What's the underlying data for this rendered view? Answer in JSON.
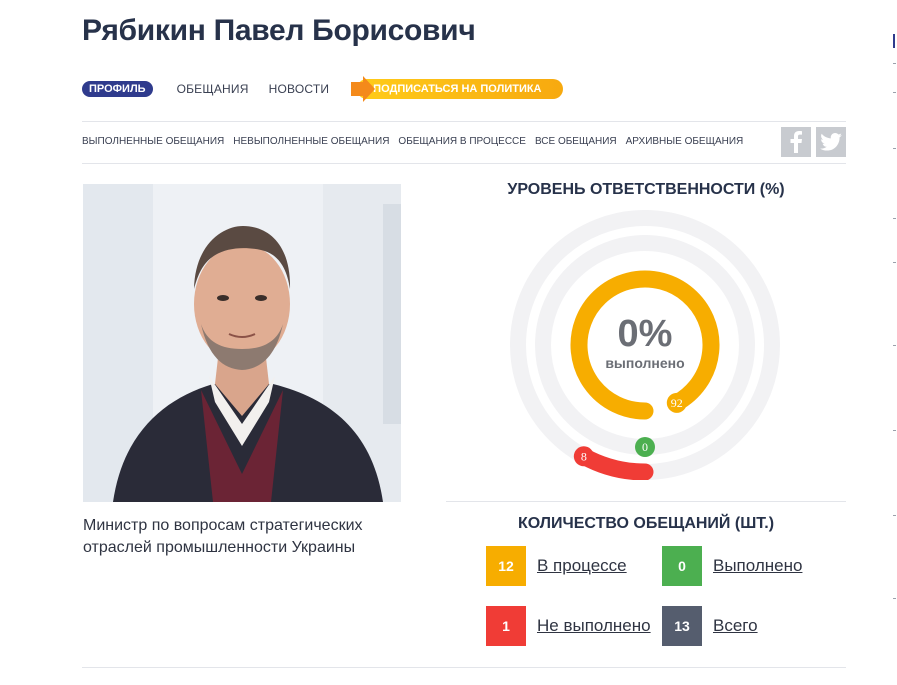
{
  "profile": {
    "name": "Рябикин Павел Борисович",
    "description": "Министр по вопросам стратегических отраслей промышленности Украины"
  },
  "nav": {
    "tabs": [
      "ПРОФИЛЬ",
      "ОБЕЩАНИЯ",
      "НОВОСТИ"
    ],
    "subscribe_label": "ПОДПИСАТЬСЯ НА ПОЛИТИКА"
  },
  "filters": [
    "ВЫПОЛНЕННЫЕ ОБЕЩАНИЯ",
    "НЕВЫПОЛНЕННЫЕ ОБЕЩАНИЯ",
    "ОБЕЩАНИЯ В ПРОЦЕССЕ",
    "ВСЕ ОБЕЩАНИЯ",
    "АРХИВНЫЕ ОБЕЩАНИЯ"
  ],
  "social": {
    "icons": [
      "facebook-icon",
      "twitter-icon"
    ]
  },
  "responsibility": {
    "heading": "УРОВЕНЬ ОТВЕТСТВЕННОСТИ (%)",
    "percent": "0%",
    "percent_caption": "выполнено",
    "rings": [
      {
        "name": "in-progress",
        "value": 92,
        "label": "92",
        "color": "#f7ad00"
      },
      {
        "name": "done",
        "value": 0,
        "label": "0",
        "color": "#4caf50"
      },
      {
        "name": "not-done",
        "value": 8,
        "label": "8",
        "color": "#f03c36"
      }
    ]
  },
  "counts": {
    "heading": "КОЛИЧЕСТВО ОБЕЩАНИЙ (ШТ.)",
    "items": [
      {
        "value": "12",
        "label": "В процессе",
        "color": "#f7ad00"
      },
      {
        "value": "0",
        "label": "Выполнено",
        "color": "#4caf50"
      },
      {
        "value": "1",
        "label": "Не выполнено",
        "color": "#f03c36"
      },
      {
        "value": "13",
        "label": "Всего",
        "color": "#555d6e"
      }
    ]
  }
}
